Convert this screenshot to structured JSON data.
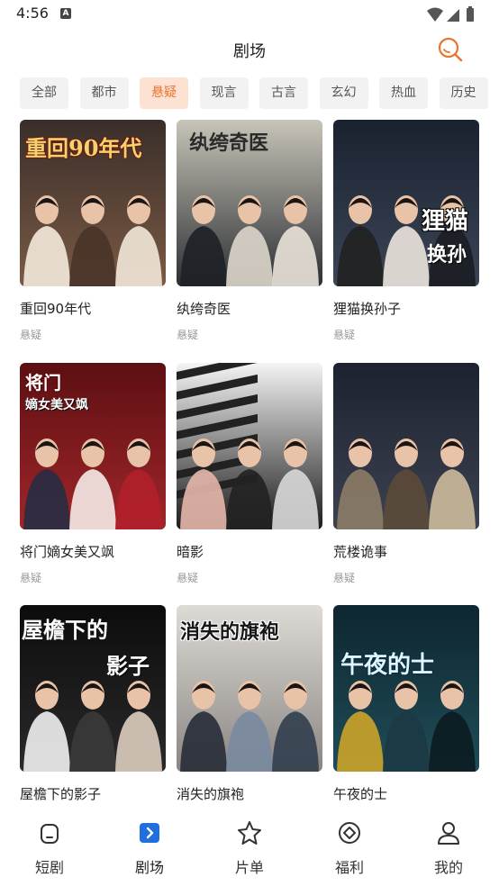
{
  "status": {
    "time": "4:56",
    "notification_glyph": "A"
  },
  "header": {
    "title": "剧场",
    "search_icon": "search-icon"
  },
  "categories": [
    {
      "label": "全部",
      "active": false
    },
    {
      "label": "都市",
      "active": false
    },
    {
      "label": "悬疑",
      "active": true
    },
    {
      "label": "现言",
      "active": false
    },
    {
      "label": "古言",
      "active": false
    },
    {
      "label": "玄幻",
      "active": false
    },
    {
      "label": "热血",
      "active": false
    },
    {
      "label": "历史",
      "active": false
    }
  ],
  "dramas": [
    {
      "title": "重回90年代",
      "tag": "悬疑",
      "poster_text": "重回90年代",
      "poster_subtext": ""
    },
    {
      "title": "纨绔奇医",
      "tag": "悬疑",
      "poster_text": "纨绔奇医",
      "poster_subtext": ""
    },
    {
      "title": "狸猫换孙子",
      "tag": "悬疑",
      "poster_text": "狸猫",
      "poster_subtext": "换孙"
    },
    {
      "title": "将门嫡女美又飒",
      "tag": "悬疑",
      "poster_text": "将门",
      "poster_subtext": "嫡女美又飒"
    },
    {
      "title": "暗影",
      "tag": "悬疑",
      "poster_text": "",
      "poster_subtext": ""
    },
    {
      "title": "荒楼诡事",
      "tag": "悬疑",
      "poster_text": "",
      "poster_subtext": ""
    },
    {
      "title": "屋檐下的影子",
      "tag": "",
      "poster_text": "屋檐下的",
      "poster_subtext": "影子"
    },
    {
      "title": "消失的旗袍",
      "tag": "",
      "poster_text": "消失的旗袍",
      "poster_subtext": ""
    },
    {
      "title": "午夜的士",
      "tag": "",
      "poster_text": "午夜的士",
      "poster_subtext": ""
    }
  ],
  "bottom_nav": [
    {
      "label": "短剧",
      "icon": "home-icon",
      "active": false
    },
    {
      "label": "剧场",
      "icon": "theater-icon",
      "active": true
    },
    {
      "label": "片单",
      "icon": "star-icon",
      "active": false
    },
    {
      "label": "福利",
      "icon": "gift-icon",
      "active": false
    },
    {
      "label": "我的",
      "icon": "profile-icon",
      "active": false
    }
  ],
  "colors": {
    "accent": "#e9742d",
    "active_nav": "#1f6fe0",
    "chip_bg": "#f2f2f2",
    "chip_active_bg": "#fde1d2"
  }
}
